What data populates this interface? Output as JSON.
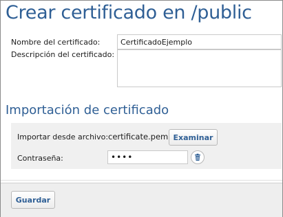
{
  "page": {
    "title": "Crear certificado en /public"
  },
  "form": {
    "name_label": "Nombre del certificado:",
    "name_value": "CertificadoEjemplo",
    "description_label": "Descripción del certificado:",
    "description_value": ""
  },
  "import_section": {
    "title": "Importación de certificado",
    "file_label": "Importar desde archivo:",
    "file_name": "certificate.pem",
    "browse_label": "Examinar",
    "password_label": "Contraseña:",
    "password_value": "••••"
  },
  "footer": {
    "save_label": "Guardar"
  },
  "icons": {
    "delete": "trash-icon"
  },
  "colors": {
    "accent": "#2f5f95",
    "panel_bg": "#f0f0f0"
  }
}
